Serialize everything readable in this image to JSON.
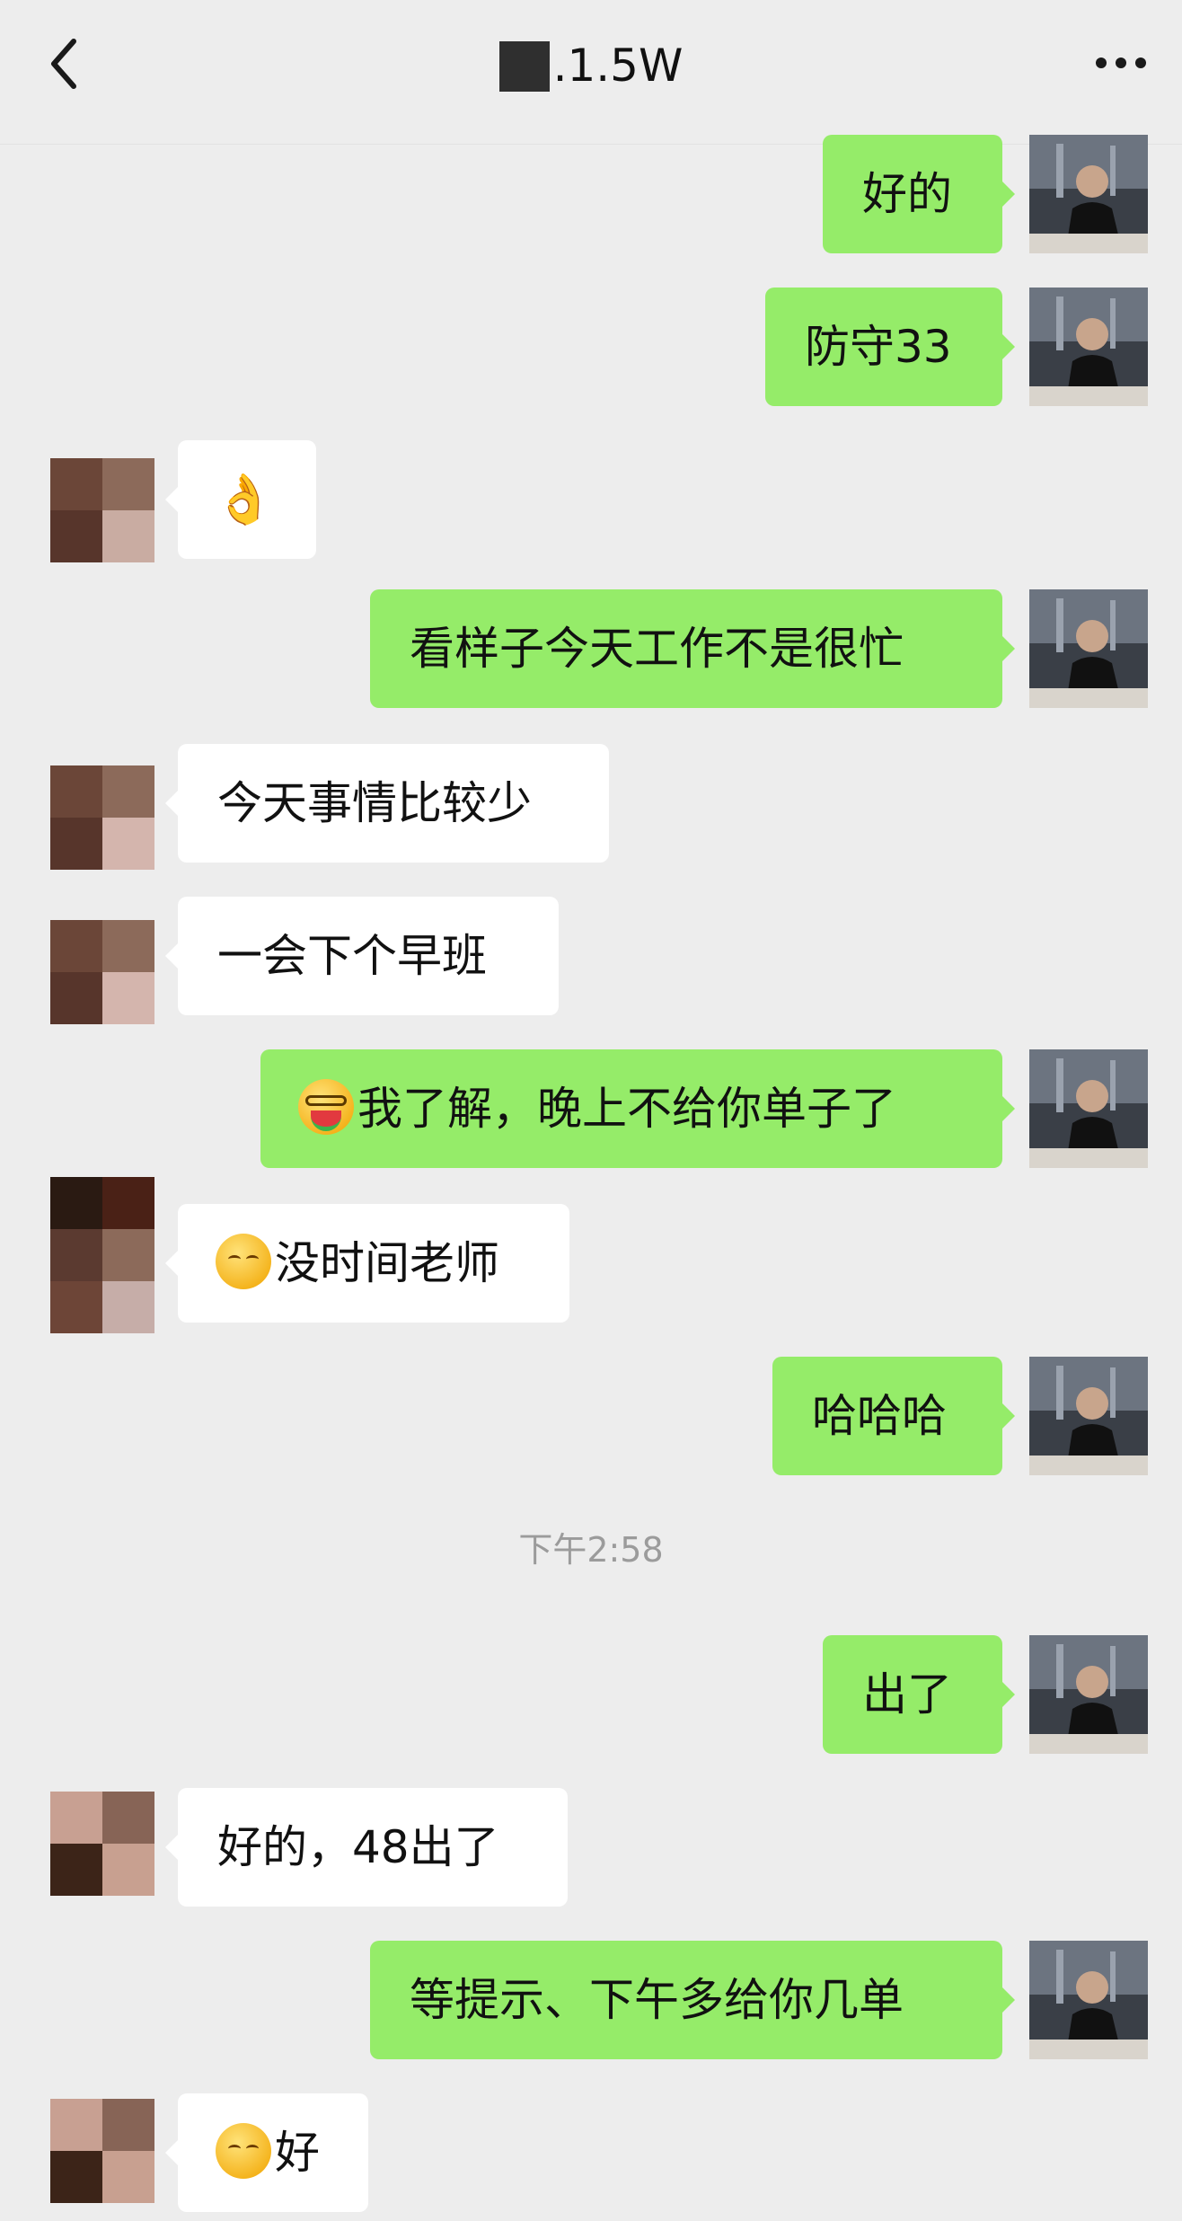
{
  "header": {
    "title": ".1.5W",
    "back_icon": "chevron-left-icon",
    "more_icon": "more-dots-icon"
  },
  "messages": [
    {
      "from": "self",
      "text": "好的"
    },
    {
      "from": "self",
      "text": "防守33"
    },
    {
      "from": "other",
      "emoji": "ok-hand-icon"
    },
    {
      "from": "self",
      "text": "看样子今天工作不是很忙"
    },
    {
      "from": "other",
      "text": "今天事情比较少"
    },
    {
      "from": "other",
      "text": "一会下个早班"
    },
    {
      "from": "self",
      "emoji": "watermelon-face-icon",
      "text": "我了解，晚上不给你单子了"
    },
    {
      "from": "other",
      "emoji": "shy-face-icon",
      "text": "没时间老师"
    },
    {
      "from": "self",
      "text": "哈哈哈"
    },
    {
      "from": "self",
      "text": "出了"
    },
    {
      "from": "other",
      "text": "好的，48出了"
    },
    {
      "from": "self",
      "text": "等提示、下午多给你几单"
    },
    {
      "from": "other",
      "emoji": "shy-face-icon",
      "text": "好"
    }
  ],
  "timestamp": "下午2:58",
  "colors": {
    "background": "#ededed",
    "self_bubble": "#95ec69",
    "other_bubble": "#ffffff",
    "timestamp_text": "#9b9b9b"
  }
}
